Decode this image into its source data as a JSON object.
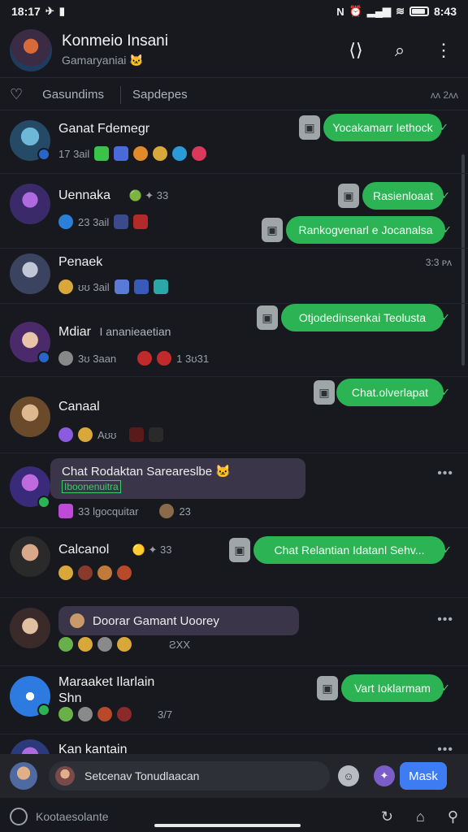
{
  "status_bar": {
    "time": "18:17",
    "right_text": "8:43"
  },
  "header": {
    "title": "Konmeio Insani",
    "subtitle": "Gamaryaniai 🐱"
  },
  "tabs": {
    "tab1": "Gasundims",
    "tab2": "Sapdepes",
    "right": "ᴧᴧ 2ᴧᴧ"
  },
  "chats": [
    {
      "name": "Ganat Fdemegr",
      "meta": "17 3ail",
      "bubble": "Yocakamarr Iethock",
      "time": ""
    },
    {
      "name": "Uennaka",
      "meta": "23 3ail",
      "name_extra": "🟢 ✦ 33",
      "bubble": "Rasienloaat",
      "bubble2": "Rankogvenarl e Jocanalsa"
    },
    {
      "name": "Penaek",
      "meta": "ʊʊ 3ail",
      "time": "3:3 ᴘᴧ"
    },
    {
      "name": "Mdiar",
      "name_extra": "I ananieaetian",
      "meta": "3ʊ 3aan",
      "meta_extra": "1 3ʊ31",
      "bubble": "Otjodedinsenkai Teolusta"
    },
    {
      "name": "Canaal",
      "meta": "Aʊʊ",
      "bubble": "Chat.olverlapat"
    },
    {
      "name": "",
      "preview": "Chat Rodaktan Sareareslbe 🐱",
      "preview_tag": "Iboonenuitra",
      "meta": "33 Ɩgocquitar",
      "meta_extra": "23"
    },
    {
      "name": "Calcanol",
      "name_extra": "🟡 ✦ 33",
      "bubble": "Chat Relantian Idatanl Sehv..."
    },
    {
      "name": "",
      "preview": "Doorar Gamant Uoorey",
      "meta": "ƧXX"
    },
    {
      "name": "Maraaket Ilarlain",
      "name2": "Shn",
      "bubble": "Vart Ioklarmam",
      "meta": "3/7"
    },
    {
      "name": "Kan kantain"
    }
  ],
  "compose": {
    "placeholder": "Setcenav Tonudlaacan",
    "send_label": "Mask"
  },
  "nav": {
    "search_text": "Kootaesolante"
  },
  "colors": {
    "accent_green": "#2bb354",
    "send_blue": "#3d7cf2",
    "bg": "#17191e"
  }
}
